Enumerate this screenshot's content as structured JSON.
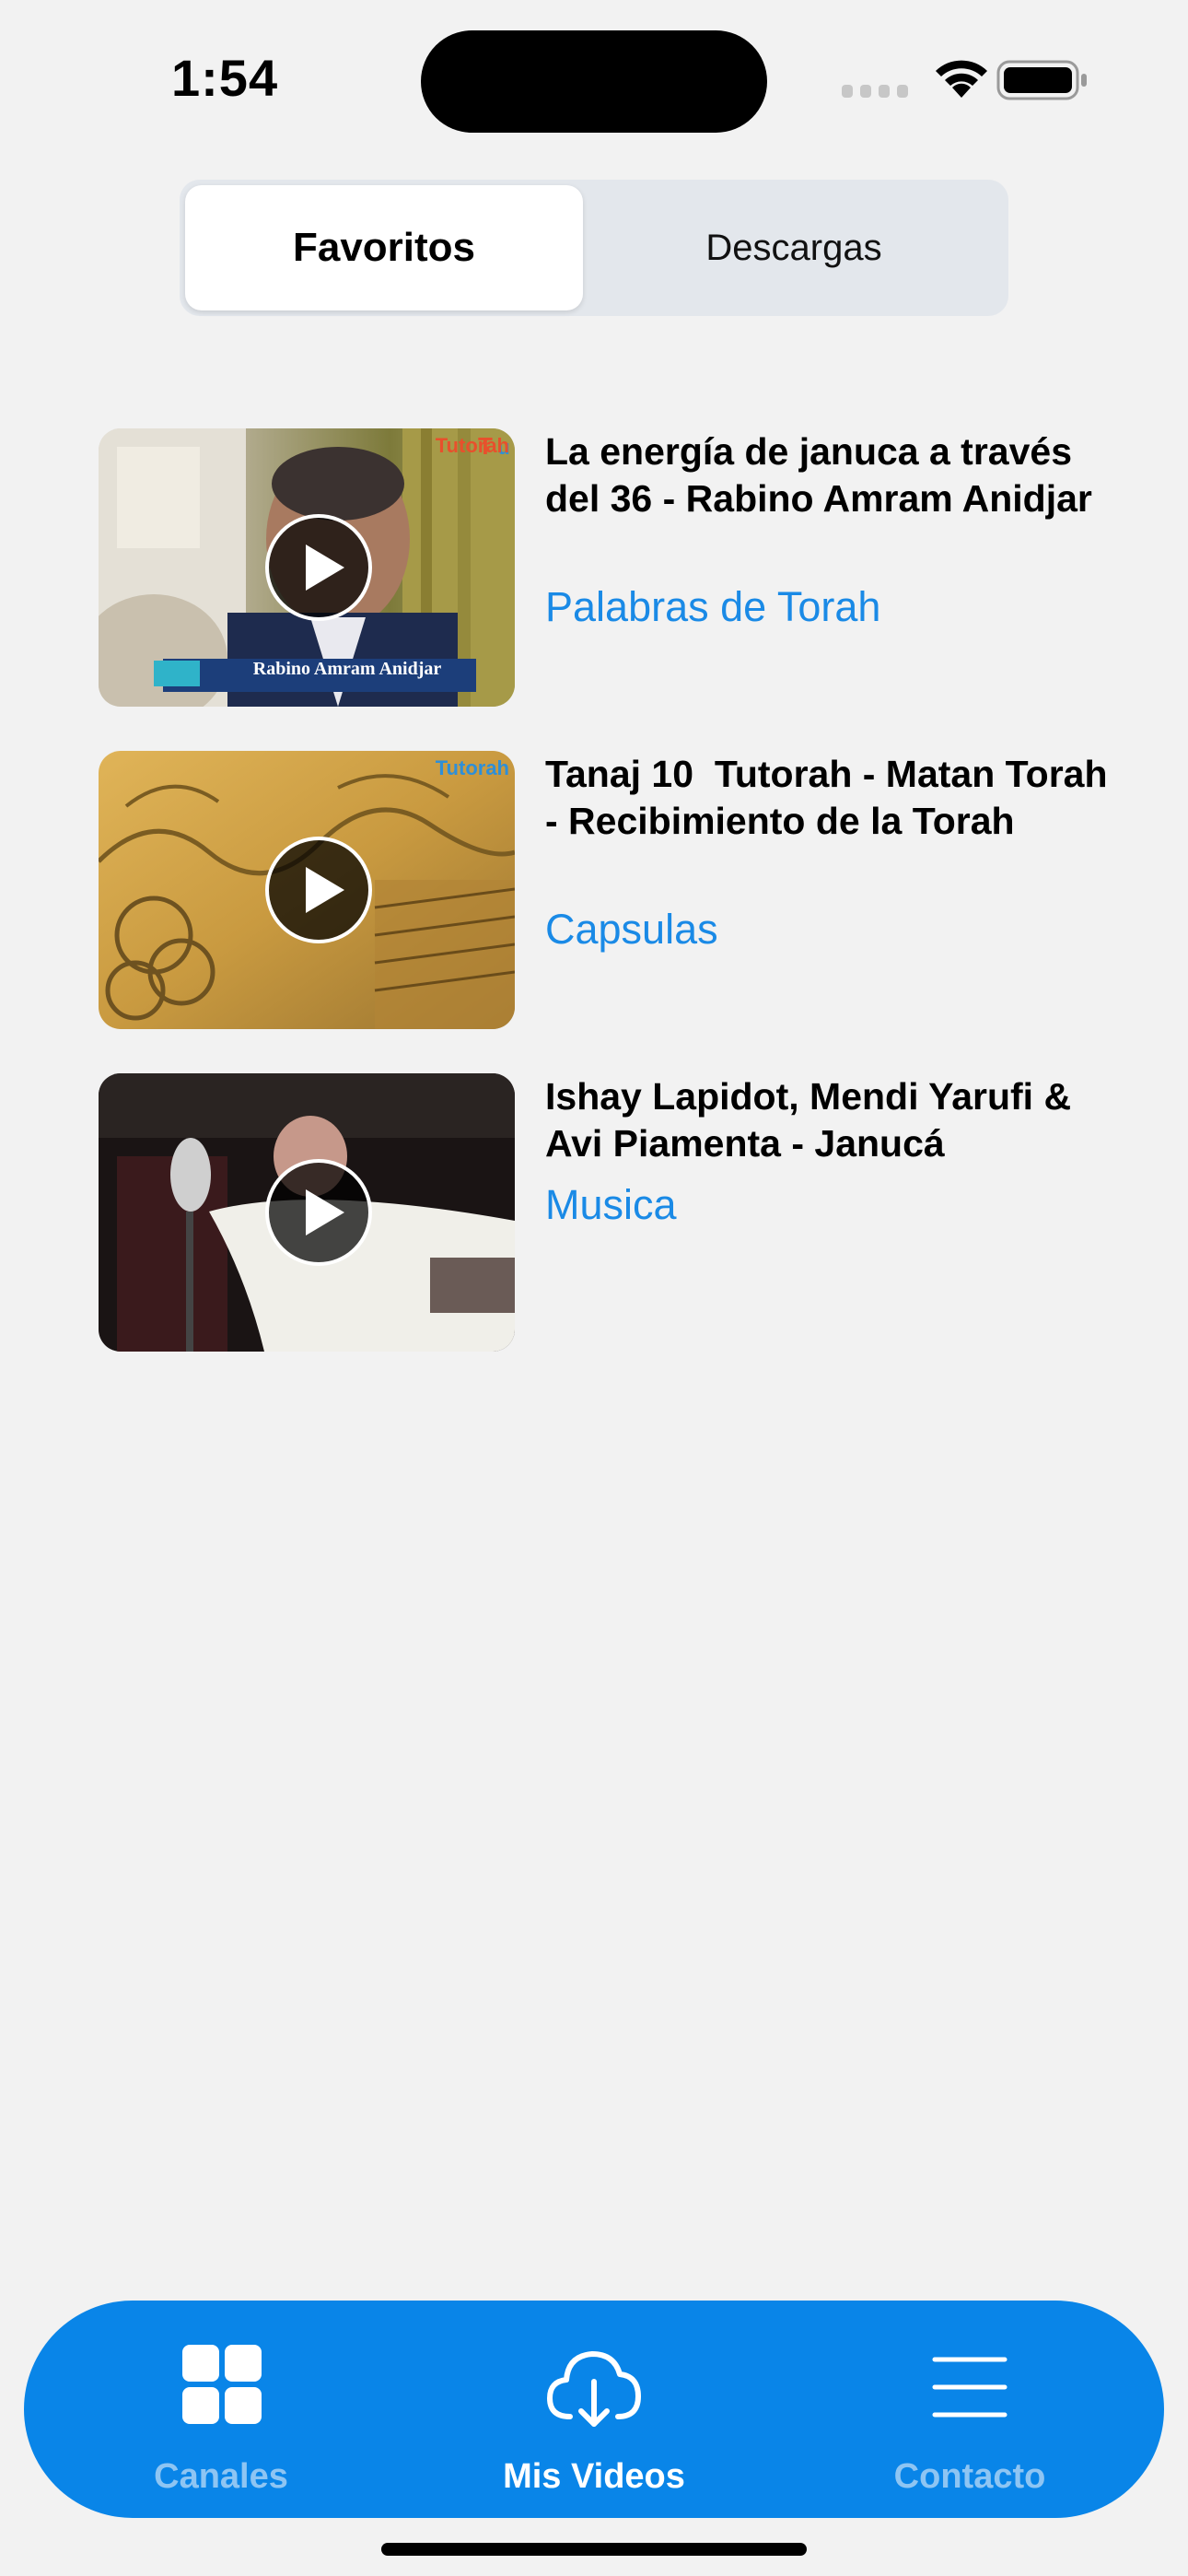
{
  "status_bar": {
    "time": "1:54"
  },
  "segmented_control": {
    "options": [
      "Favoritos",
      "Descargas"
    ],
    "selected": "Favoritos"
  },
  "videos": [
    {
      "title": "La energía de januca a través del 36 - Rabino Amram Anidjar",
      "channel": "Palabras de Torah",
      "thumbnail_overlay": {
        "logo": "Tutorah",
        "lower_third": "Rabino Amram Anidjar"
      }
    },
    {
      "title": "Tanaj 10  Tutorah - Matan Torah - Recibimiento de la Torah",
      "channel": "Capsulas",
      "thumbnail_overlay": {
        "logo": "Tutorah"
      }
    },
    {
      "title": "Ishay Lapidot, Mendi Yarufi & Avi Piamenta - Janucá",
      "channel": "Musica"
    }
  ],
  "tab_bar": {
    "tabs": [
      {
        "label": "Canales",
        "icon": "grid-icon",
        "active": false
      },
      {
        "label": "Mis Videos",
        "icon": "cloud-download-icon",
        "active": true
      },
      {
        "label": "Contacto",
        "icon": "menu-icon",
        "active": false
      }
    ],
    "colors": {
      "background": "#0985e8",
      "active_label": "#ffffff",
      "inactive_label": "#8ec5f3"
    }
  },
  "colors": {
    "page_background": "#f2f2f2",
    "link_blue": "#1a8ae6",
    "segmented_background": "#e3e7ec"
  }
}
